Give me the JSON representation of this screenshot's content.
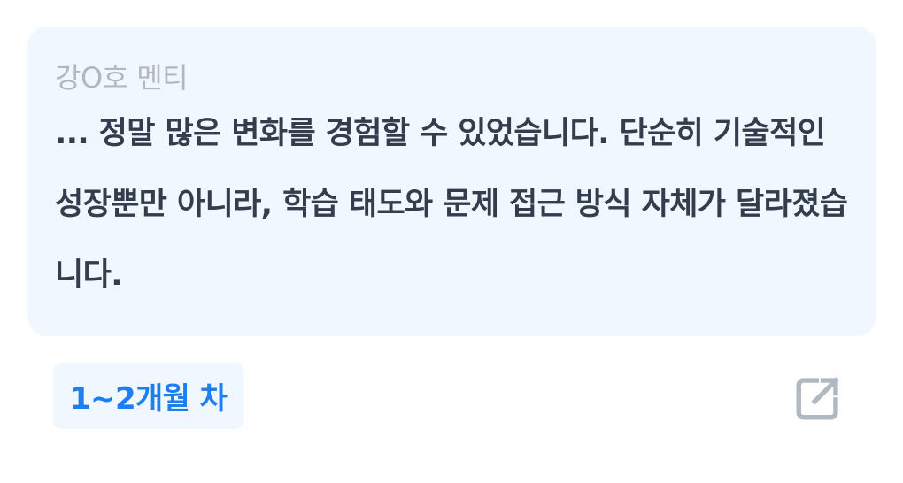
{
  "card": {
    "mentee_name": "강O호 멘티",
    "quote": "... 정말 많은 변화를 경험할 수 있었습니다. 단순히 기술적인 성장뿐만 아니라, 학습 태도와 문제 접근 방식 자체가 달라졌습니다."
  },
  "badge": {
    "period_label": "1~2개월 차"
  },
  "icons": {
    "open_link": "open-in-new-icon"
  },
  "colors": {
    "card_background": "#f1f7fe",
    "name_text": "#b3b8bf",
    "quote_text": "#333d4b",
    "badge_text": "#1c7ef0",
    "icon": "#b0b8c1"
  }
}
